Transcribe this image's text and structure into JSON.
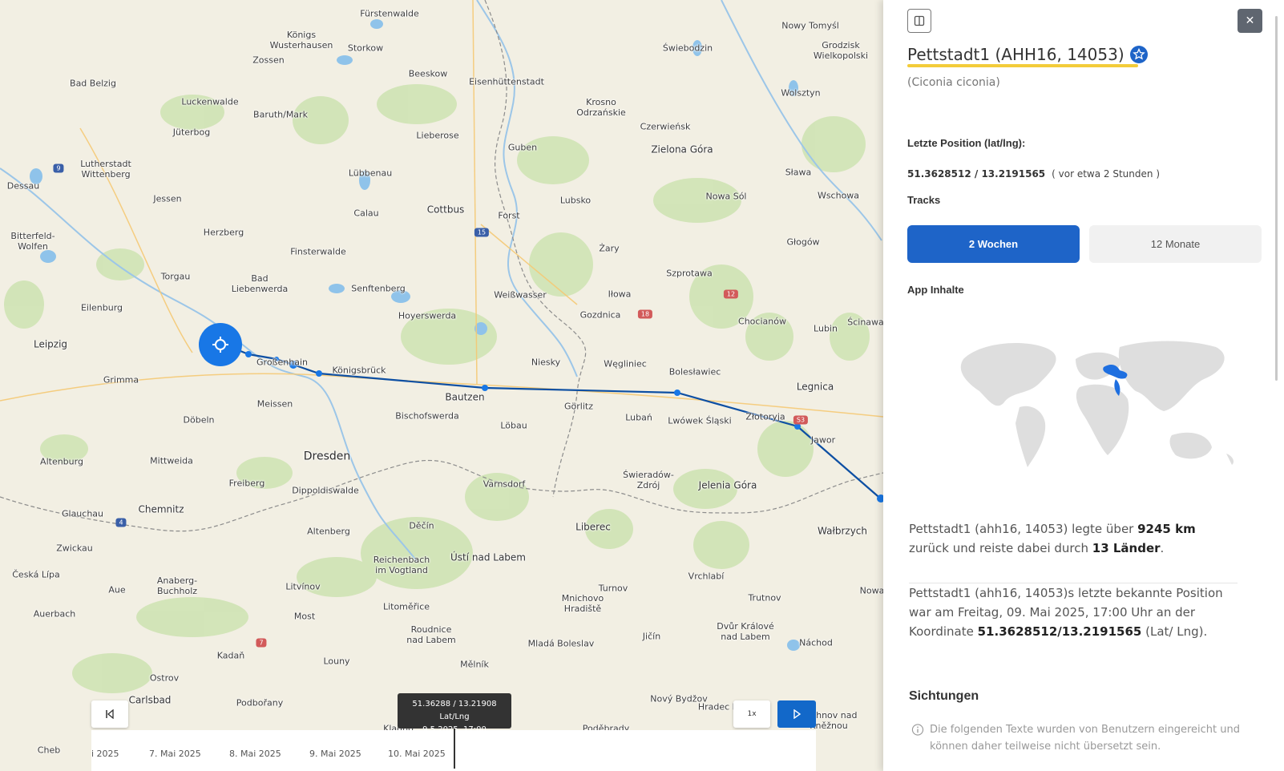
{
  "map": {
    "places": [
      {
        "name": "Königs\nWusterhausen",
        "cls": ""
      },
      {
        "name": "Fürstenwalde",
        "cls": ""
      },
      {
        "name": "Storkow",
        "cls": ""
      },
      {
        "name": "Zossen",
        "cls": ""
      },
      {
        "name": "Bad Belzig",
        "cls": ""
      },
      {
        "name": "Luckenwalde",
        "cls": ""
      },
      {
        "name": "Baruth/Mark",
        "cls": ""
      },
      {
        "name": "Jüterbog",
        "cls": ""
      },
      {
        "name": "Beeskow",
        "cls": ""
      },
      {
        "name": "Eisenhüttenstadt",
        "cls": ""
      },
      {
        "name": "Świebodzin",
        "cls": ""
      },
      {
        "name": "Nowy Tomyśl",
        "cls": ""
      },
      {
        "name": "Grodzisk\nWielkopolski",
        "cls": ""
      },
      {
        "name": "Wolsztyn",
        "cls": ""
      },
      {
        "name": "Krosno\nOdrzańskie",
        "cls": ""
      },
      {
        "name": "Czerwieńsk",
        "cls": ""
      },
      {
        "name": "Zielona Góra",
        "cls": "med"
      },
      {
        "name": "Lutherstadt\nWittenberg",
        "cls": ""
      },
      {
        "name": "Lieberose",
        "cls": ""
      },
      {
        "name": "Guben",
        "cls": ""
      },
      {
        "name": "Dessau",
        "cls": ""
      },
      {
        "name": "Jessen",
        "cls": ""
      },
      {
        "name": "Lübbenau",
        "cls": ""
      },
      {
        "name": "Cottbus",
        "cls": "med"
      },
      {
        "name": "Lubsko",
        "cls": ""
      },
      {
        "name": "Nowa Sól",
        "cls": ""
      },
      {
        "name": "Sława",
        "cls": ""
      },
      {
        "name": "Wschowa",
        "cls": ""
      },
      {
        "name": "Calau",
        "cls": ""
      },
      {
        "name": "Forst",
        "cls": ""
      },
      {
        "name": "Herzberg",
        "cls": ""
      },
      {
        "name": "Bitterfeld-\nWolfen",
        "cls": ""
      },
      {
        "name": "Żary",
        "cls": ""
      },
      {
        "name": "Głogów",
        "cls": ""
      },
      {
        "name": "Finsterwalde",
        "cls": ""
      },
      {
        "name": "Torgau",
        "cls": ""
      },
      {
        "name": "Bad\nLiebenwerda",
        "cls": ""
      },
      {
        "name": "Senftenberg",
        "cls": ""
      },
      {
        "name": "Szprotawa",
        "cls": ""
      },
      {
        "name": "Weißwasser",
        "cls": ""
      },
      {
        "name": "Iłowa",
        "cls": ""
      },
      {
        "name": "Eilenburg",
        "cls": ""
      },
      {
        "name": "Hoyerswerda",
        "cls": ""
      },
      {
        "name": "Gozdnica",
        "cls": ""
      },
      {
        "name": "Chocianów",
        "cls": ""
      },
      {
        "name": "Lubin",
        "cls": ""
      },
      {
        "name": "Ścinawa",
        "cls": ""
      },
      {
        "name": "Leipzig",
        "cls": "med"
      },
      {
        "name": "Großenhain",
        "cls": ""
      },
      {
        "name": "Königsbrück",
        "cls": ""
      },
      {
        "name": "Niesky",
        "cls": ""
      },
      {
        "name": "Węgliniec",
        "cls": ""
      },
      {
        "name": "Bolesławiec",
        "cls": ""
      },
      {
        "name": "Legnica",
        "cls": "med"
      },
      {
        "name": "Grimma",
        "cls": ""
      },
      {
        "name": "Bautzen",
        "cls": "med"
      },
      {
        "name": "Görlitz",
        "cls": ""
      },
      {
        "name": "Meissen",
        "cls": ""
      },
      {
        "name": "Lubań",
        "cls": ""
      },
      {
        "name": "Lwówek Śląski",
        "cls": ""
      },
      {
        "name": "Złotoryja",
        "cls": ""
      },
      {
        "name": "Jawor",
        "cls": ""
      },
      {
        "name": "Döbeln",
        "cls": ""
      },
      {
        "name": "Bischofswerda",
        "cls": ""
      },
      {
        "name": "Löbau",
        "cls": ""
      },
      {
        "name": "Altenburg",
        "cls": ""
      },
      {
        "name": "Mittweida",
        "cls": ""
      },
      {
        "name": "Dresden",
        "cls": "big"
      },
      {
        "name": "Świeradów-\nZdrój",
        "cls": ""
      },
      {
        "name": "Jelenia Góra",
        "cls": "med"
      },
      {
        "name": "Freiberg",
        "cls": ""
      },
      {
        "name": "Dippoldiswalde",
        "cls": ""
      },
      {
        "name": "Varnsdorf",
        "cls": ""
      },
      {
        "name": "Glauchau",
        "cls": ""
      },
      {
        "name": "Chemnitz",
        "cls": "med"
      },
      {
        "name": "Děčín",
        "cls": ""
      },
      {
        "name": "Liberec",
        "cls": "med"
      },
      {
        "name": "Wałbrzych",
        "cls": "med"
      },
      {
        "name": "Zwickau",
        "cls": ""
      },
      {
        "name": "Altenberg",
        "cls": ""
      },
      {
        "name": "Reichenbach\nim Vogtland",
        "cls": ""
      },
      {
        "name": "Ústí nad Labem",
        "cls": "med"
      },
      {
        "name": "Česká Lípa",
        "cls": ""
      },
      {
        "name": "Anaberg-\nBuchholz",
        "cls": ""
      },
      {
        "name": "Aue",
        "cls": ""
      },
      {
        "name": "Litvínov",
        "cls": ""
      },
      {
        "name": "Vrchlabí",
        "cls": ""
      },
      {
        "name": "Turnov",
        "cls": ""
      },
      {
        "name": "Trutnov",
        "cls": ""
      },
      {
        "name": "Mnichovo\nHradiště",
        "cls": ""
      },
      {
        "name": "Auerbach",
        "cls": ""
      },
      {
        "name": "Most",
        "cls": ""
      },
      {
        "name": "Litoměřice",
        "cls": ""
      },
      {
        "name": "Roudnice\nnad Labem",
        "cls": ""
      },
      {
        "name": "Jičín",
        "cls": ""
      },
      {
        "name": "Dvůr Králové\nnad Labem",
        "cls": ""
      },
      {
        "name": "Náchod",
        "cls": ""
      },
      {
        "name": "Mladá Boleslav",
        "cls": ""
      },
      {
        "name": "Kadaň",
        "cls": ""
      },
      {
        "name": "Louny",
        "cls": ""
      },
      {
        "name": "Mělník",
        "cls": ""
      },
      {
        "name": "Ostrov",
        "cls": ""
      },
      {
        "name": "Nový Bydžov",
        "cls": ""
      },
      {
        "name": "Carlsbad",
        "cls": "med"
      },
      {
        "name": "Podbořany",
        "cls": ""
      },
      {
        "name": "Hradec Králové",
        "cls": ""
      },
      {
        "name": "Rychnov nad\nKněžnou",
        "cls": ""
      },
      {
        "name": "Kladno",
        "cls": ""
      },
      {
        "name": "Poděbrady",
        "cls": ""
      },
      {
        "name": "Cheb",
        "cls": ""
      },
      {
        "name": "Nowa",
        "cls": ""
      }
    ],
    "roads": [
      {
        "num": "9",
        "color": "#3a5fa8"
      },
      {
        "num": "15",
        "color": "#3a5fa8"
      },
      {
        "num": "12",
        "color": "#d25a5a"
      },
      {
        "num": "18",
        "color": "#d25a5a"
      },
      {
        "num": "S3",
        "color": "#d25a5a"
      },
      {
        "num": "4",
        "color": "#3a5fa8"
      },
      {
        "num": "7",
        "color": "#d25a5a"
      }
    ],
    "tooltip": {
      "coords": "51.36288 / 13.21908 Lat/Lng",
      "datetime": "9.5.2025, 17:00"
    },
    "speed_label": "1x",
    "timeline": [
      "i 2025",
      "7. Mai 2025",
      "8. Mai 2025",
      "9. Mai 2025",
      "10. Mai 2025"
    ],
    "colors": {
      "track": "#0d4fa3",
      "marker": "#1877e6",
      "play": "#1268c9"
    }
  },
  "panel": {
    "title": "Pettstadt1 (AHH16, 14053)",
    "species": "(Ciconia ciconia)",
    "last_position_label": "Letzte Position (lat/lng):",
    "last_position_value": "51.3628512 / 13.2191565",
    "last_position_ago": "( vor etwa 2 Stunden )",
    "tracks_label": "Tracks",
    "track_buttons": [
      "2 Wochen",
      "12 Monate"
    ],
    "app_content_label": "App Inhalte",
    "summary": {
      "prefix": "Pettstadt1 (ahh16, 14053) legte über ",
      "distance": "9245 km",
      "middle": " zurück und reiste dabei durch ",
      "countries": "13 Länder",
      "suffix": "."
    },
    "last_known": {
      "prefix": "Pettstadt1 (ahh16, 14053)s letzte bekannte Position war am Freitag, 09. Mai 2025, 17:00 Uhr an der Koordinate ",
      "coords": "51.3628512/13.2191565",
      "suffix": " (Lat/ Lng)."
    },
    "sightings_title": "Sichtungen",
    "sightings_note": "Die folgenden Texte wurden von Benutzern eingereicht und können daher teilweise nicht übersetzt sein.",
    "colors": {
      "accent": "#1e64c8",
      "underline": "#f3cc3a"
    }
  }
}
